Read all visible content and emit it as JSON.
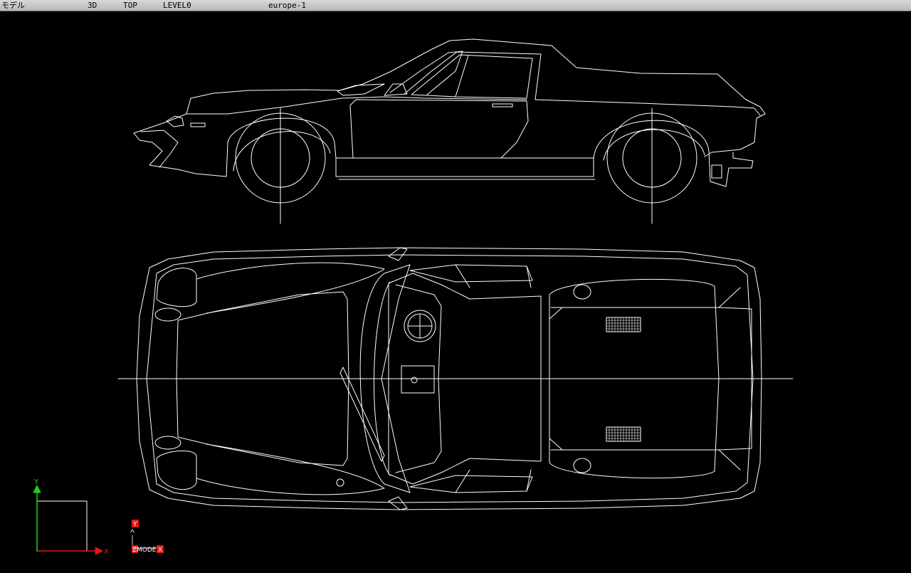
{
  "status_bar": {
    "mode": "モデル",
    "dimension": "3D",
    "view": "TOP",
    "level": "LEVEL0",
    "file": "europe-1"
  },
  "axes": {
    "x_label": "X",
    "y_label": "Y",
    "x_color": "#e01818",
    "y_color": "#20d020"
  },
  "model_tag": {
    "y_label": "Y",
    "z_label": "Z",
    "model_label": "MODEL",
    "x_label": "X",
    "tag_color": "#e01818"
  },
  "drawing": {
    "line_color": "#ffffff",
    "side_view": "side-elevation",
    "top_view": "plan-view"
  }
}
